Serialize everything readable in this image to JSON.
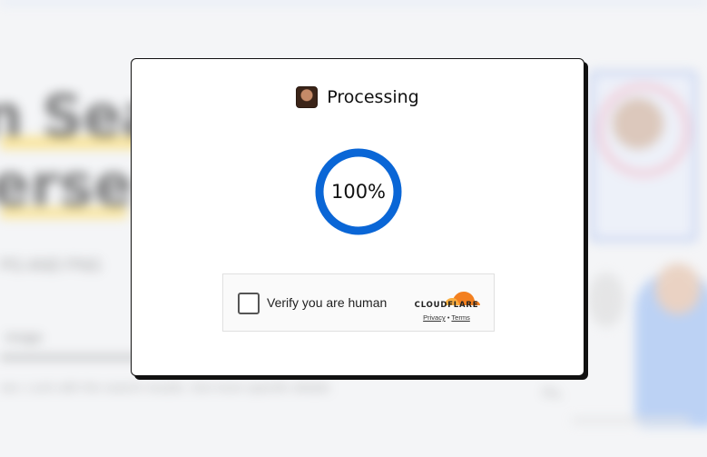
{
  "modal": {
    "title": "Processing",
    "progress_text": "100%",
    "progress": 1.0,
    "ring_color": "#0a66d6"
  },
  "captcha": {
    "label": "Verify you are human",
    "brand": "CLOUDFLARE",
    "privacy_link": "Privacy",
    "separator": "•",
    "terms_link": "Terms",
    "brand_color": "#f38020"
  },
  "icons": {
    "avatar": "avatar-thumbnail",
    "checkbox": "checkbox-empty",
    "cloud": "cloudflare-cloud-logo"
  }
}
